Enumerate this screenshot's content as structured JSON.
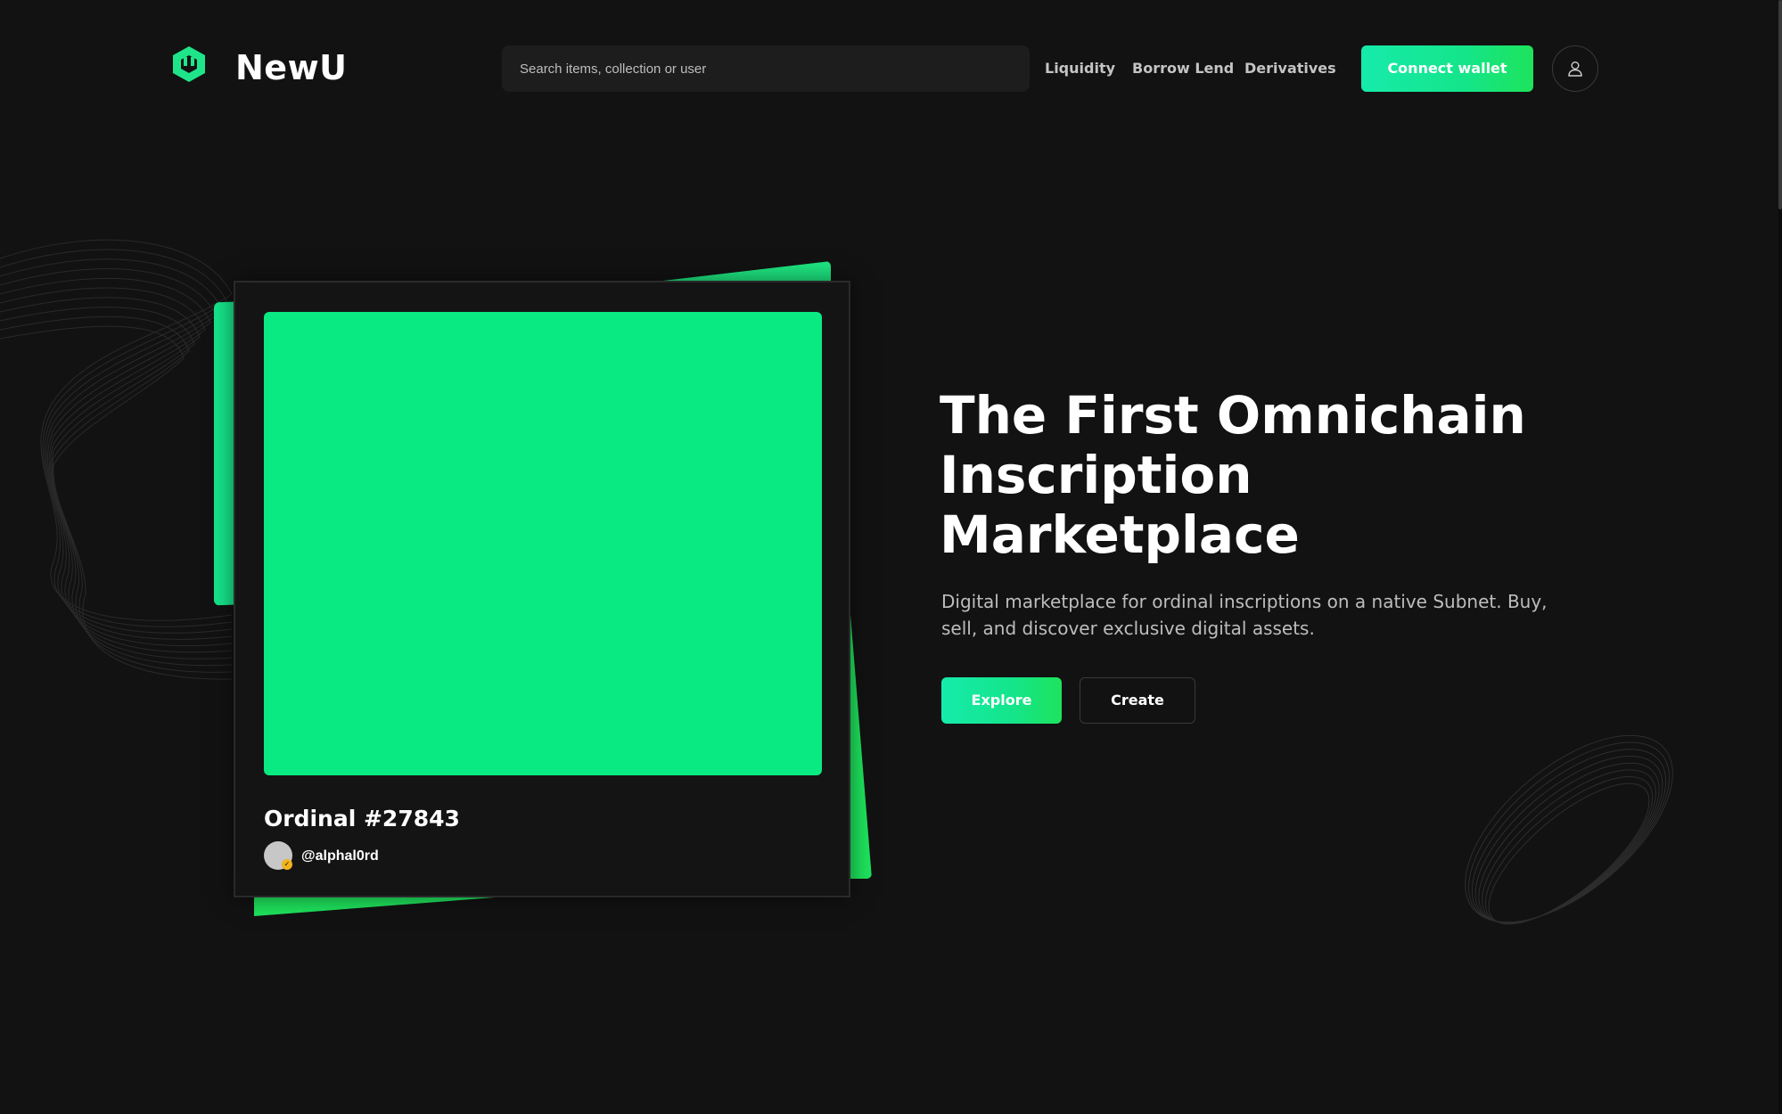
{
  "header": {
    "brand": "NewU",
    "search_placeholder": "Search items, collection or user",
    "nav": [
      "Liquidity",
      "Borrow Lend",
      "Derivatives"
    ],
    "connect_label": "Connect wallet"
  },
  "hero": {
    "title_lines": [
      "The First Omnichain",
      "Inscription",
      "Marketplace"
    ],
    "subtitle_lines": [
      "Digital marketplace for ordinal inscriptions on a native Subnet. Buy,",
      "sell, and discover exclusive digital assets."
    ],
    "explore_label": "Explore",
    "create_label": "Create"
  },
  "card": {
    "title": "Ordinal #27843",
    "user": "@alphal0rd",
    "image_color": "#0aea83"
  },
  "colors": {
    "background": "#121212",
    "accent": "#14e58a",
    "accent_start": "#16ebab",
    "accent_end": "#1ee35c",
    "badge": "#f3b31c"
  },
  "icons": {
    "logo": "hexagon-logo-icon",
    "user": "user-icon",
    "verified": "verified-badge-icon"
  }
}
